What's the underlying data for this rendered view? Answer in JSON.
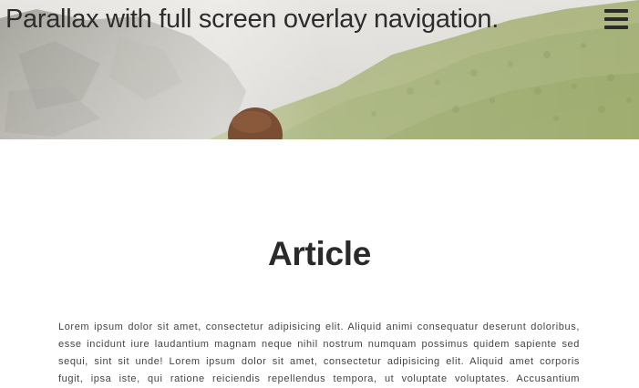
{
  "hero": {
    "title": "Parallax with full screen overlay navigation.",
    "image": "mountain-landscape-with-person"
  },
  "header": {
    "menu_icon": "hamburger-menu-icon"
  },
  "article": {
    "heading": "Article",
    "body": "Lorem ipsum dolor sit amet, consectetur adipisicing elit. Aliquid animi consequatur deserunt doloribus, esse incidunt iure laudantium magnam neque nihil nostrum numquam possimus quidem sapiente sed sequi, sint sit unde! Lorem ipsum dolor sit amet, consectetur adipisicing elit. Aliquid amet corporis fugit, ipsa iste, qui ratione reiciendis repellendus tempora, ut voluptate voluptates. Accusantium aliquam asperiores atque autem,"
  },
  "colors": {
    "title_text": "#2d2d2d",
    "heading_text": "#2a2a2a",
    "body_text": "#444444",
    "background": "#ffffff"
  }
}
